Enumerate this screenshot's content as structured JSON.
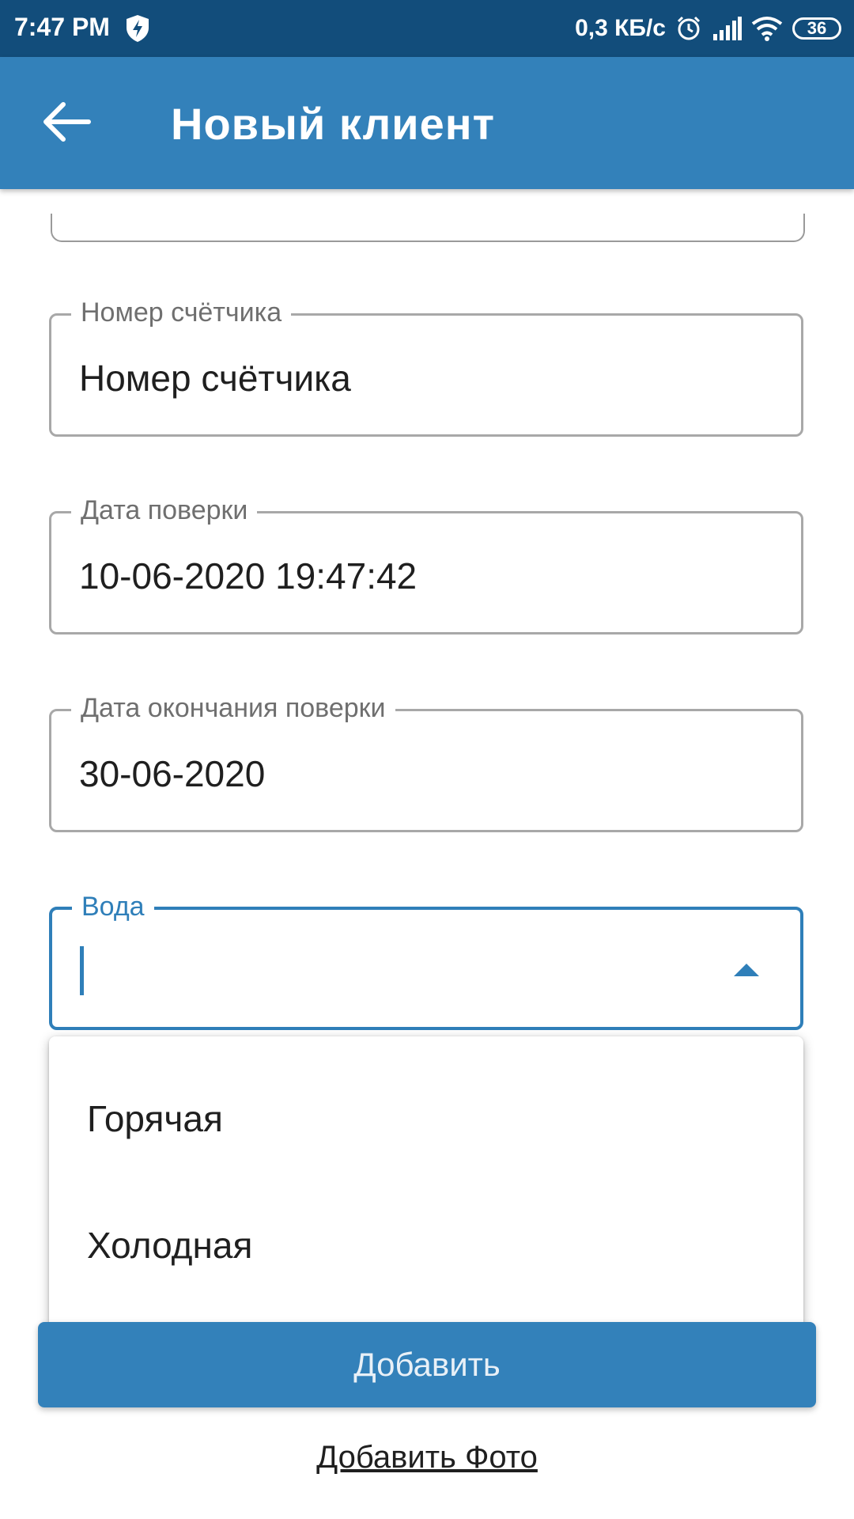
{
  "status_bar": {
    "time": "7:47 PM",
    "network_speed": "0,3 КБ/с",
    "battery": "36"
  },
  "app_bar": {
    "title": "Новый клиент"
  },
  "form": {
    "meter_number": {
      "label": "Номер счётчика",
      "value": "Номер счётчика"
    },
    "verification_date": {
      "label": "Дата поверки",
      "value": "10-06-2020 19:47:42"
    },
    "verification_end_date": {
      "label": "Дата окончания поверки",
      "value": "30-06-2020"
    },
    "water": {
      "label": "Вода",
      "value": ""
    }
  },
  "dropdown": {
    "options": [
      "Горячая",
      "Холодная"
    ]
  },
  "actions": {
    "add_label": "Добавить",
    "add_photo_label": "Добавить Фото"
  },
  "colors": {
    "status_bar": "#124d7b",
    "primary": "#3381ba"
  }
}
